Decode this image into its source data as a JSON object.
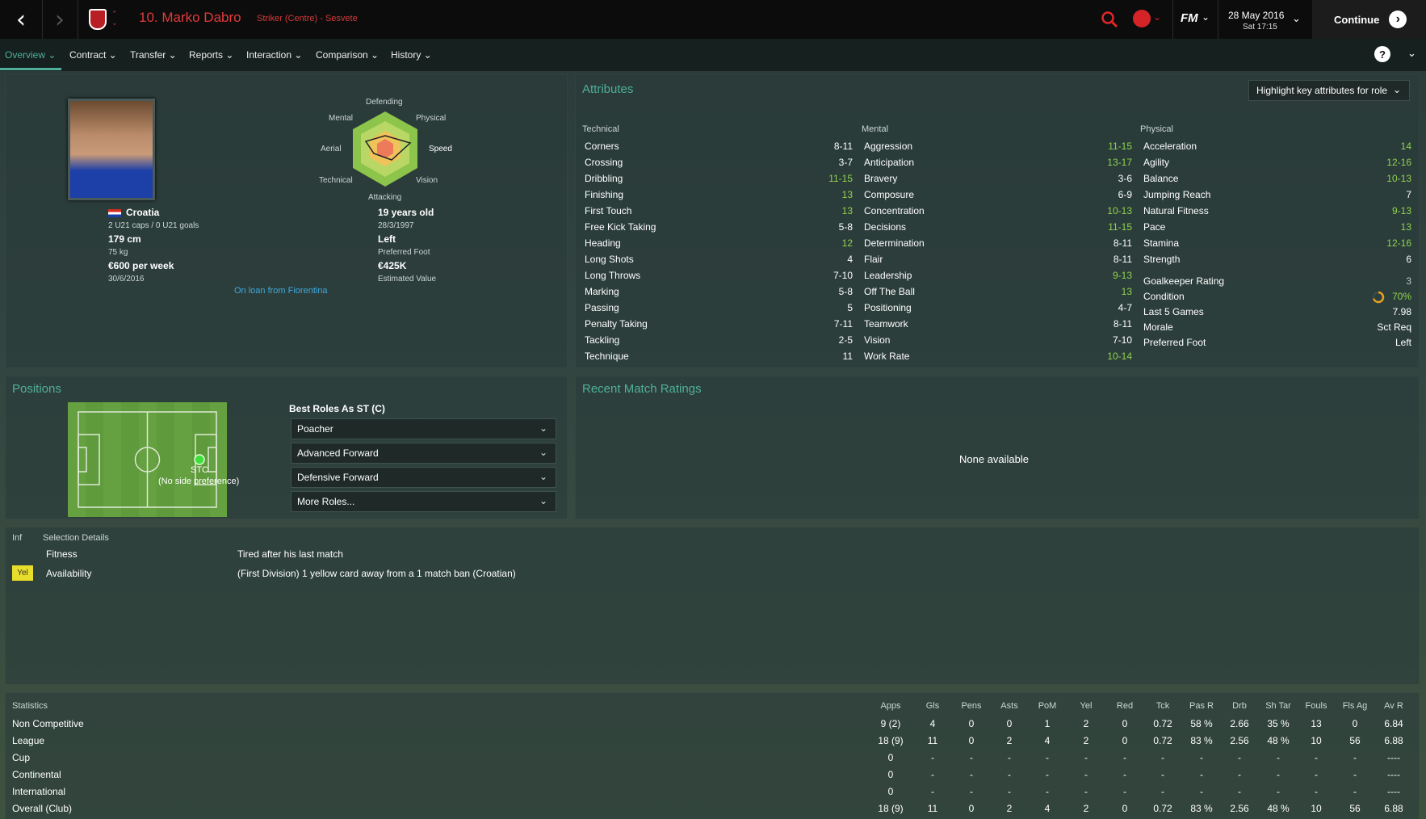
{
  "topbar": {
    "title": "10. Marko Dabro",
    "subtitle": "Striker (Centre) - Sesvete",
    "date": "28 May 2016",
    "day_time": "Sat 17:15",
    "continue": "Continue",
    "logo": "FM"
  },
  "tabs": [
    {
      "label": "Overview ⌄"
    },
    {
      "label": "Contract ⌄"
    },
    {
      "label": "Transfer ⌄"
    },
    {
      "label": "Reports ⌄"
    },
    {
      "label": "Interaction ⌄"
    },
    {
      "label": "Comparison ⌄"
    },
    {
      "label": "History ⌄"
    }
  ],
  "profile": {
    "nation": "Croatia",
    "caps": "2 U21 caps / 0 U21 goals",
    "height": "179 cm",
    "weight": "75 kg",
    "wage": "€600 per week",
    "contract_end": "30/6/2016",
    "age": "19 years old",
    "dob": "28/3/1997",
    "foot": "Left",
    "foot_label": "Preferred Foot",
    "value": "€425K",
    "value_label": "Estimated Value",
    "loan": "On loan from Fiorentina"
  },
  "radar": {
    "labels": {
      "top": "Defending",
      "tr": "Physical",
      "right": "Speed",
      "br": "Vision",
      "bottom": "Attacking",
      "bl": "Technical",
      "left": "Aerial",
      "tl": "Mental"
    }
  },
  "attributes": {
    "title": "Attributes",
    "highlight": "Highlight key attributes for role",
    "technical_title": "Technical",
    "mental_title": "Mental",
    "physical_title": "Physical",
    "technical": [
      [
        "Corners",
        "8-11"
      ],
      [
        "Crossing",
        "3-7"
      ],
      [
        "Dribbling",
        "11-15"
      ],
      [
        "Finishing",
        "13"
      ],
      [
        "First Touch",
        "13"
      ],
      [
        "Free Kick Taking",
        "5-8"
      ],
      [
        "Heading",
        "12"
      ],
      [
        "Long Shots",
        "4"
      ],
      [
        "Long Throws",
        "7-10"
      ],
      [
        "Marking",
        "5-8"
      ],
      [
        "Passing",
        "5"
      ],
      [
        "Penalty Taking",
        "7-11"
      ],
      [
        "Tackling",
        "2-5"
      ],
      [
        "Technique",
        "11"
      ]
    ],
    "mental": [
      [
        "Aggression",
        "11-15"
      ],
      [
        "Anticipation",
        "13-17"
      ],
      [
        "Bravery",
        "3-6"
      ],
      [
        "Composure",
        "6-9"
      ],
      [
        "Concentration",
        "10-13"
      ],
      [
        "Decisions",
        "11-15"
      ],
      [
        "Determination",
        "8-11"
      ],
      [
        "Flair",
        "8-11"
      ],
      [
        "Leadership",
        "9-13"
      ],
      [
        "Off The Ball",
        "13"
      ],
      [
        "Positioning",
        "4-7"
      ],
      [
        "Teamwork",
        "8-11"
      ],
      [
        "Vision",
        "7-10"
      ],
      [
        "Work Rate",
        "10-14"
      ]
    ],
    "physical": [
      [
        "Acceleration",
        "14"
      ],
      [
        "Agility",
        "12-16"
      ],
      [
        "Balance",
        "10-13"
      ],
      [
        "Jumping Reach",
        "7"
      ],
      [
        "Natural Fitness",
        "9-13"
      ],
      [
        "Pace",
        "13"
      ],
      [
        "Stamina",
        "12-16"
      ],
      [
        "Strength",
        "6"
      ]
    ],
    "extra": [
      [
        "Goalkeeper Rating",
        "3"
      ],
      [
        "Condition",
        "70%"
      ],
      [
        "Last 5 Games",
        "7.98"
      ],
      [
        "Morale",
        "Sct Req"
      ],
      [
        "Preferred Foot",
        "Left"
      ]
    ],
    "condition": 0.7,
    "colors": {
      "good": "#8fd24e",
      "normal": "#ffffff",
      "dim": "#c0c8c6"
    }
  },
  "positions": {
    "title": "Positions",
    "marker": "STC",
    "marker_note": "(No side preference)",
    "best_roles_title": "Best Roles As ST (C)",
    "roles": [
      "Poacher",
      "Advanced Forward",
      "Defensive Forward",
      "More Roles..."
    ]
  },
  "ratings": {
    "title": "Recent Match Ratings",
    "empty": "None available"
  },
  "selection": {
    "col1": "Inf",
    "col2": "Selection Details",
    "rows": [
      {
        "badge": "",
        "label": "Fitness",
        "detail": "Tired after his last match"
      },
      {
        "badge": "Yel",
        "label": "Availability",
        "detail": "(First Division) 1 yellow card away from a 1 match ban (Croatian)"
      }
    ]
  },
  "stats": {
    "title": "Statistics",
    "headers": [
      "Apps",
      "Gls",
      "Pens",
      "Asts",
      "PoM",
      "Yel",
      "Red",
      "Tck",
      "Pas R",
      "Drb",
      "Sh Tar",
      "Fouls",
      "Fls Ag",
      "Av R"
    ],
    "rows": [
      {
        "name": "Non Competitive",
        "v": [
          "9 (2)",
          "4",
          "0",
          "0",
          "1",
          "2",
          "0",
          "0.72",
          "58 %",
          "2.66",
          "35 %",
          "13",
          "0",
          "6.84"
        ]
      },
      {
        "name": "League",
        "v": [
          "18 (9)",
          "11",
          "0",
          "2",
          "4",
          "2",
          "0",
          "0.72",
          "83 %",
          "2.56",
          "48 %",
          "10",
          "56",
          "6.88"
        ]
      },
      {
        "name": "Cup",
        "v": [
          "0",
          "-",
          "-",
          "-",
          "-",
          "-",
          "-",
          "-",
          "-",
          "-",
          "-",
          "-",
          "-",
          "----"
        ]
      },
      {
        "name": "Continental",
        "v": [
          "0",
          "-",
          "-",
          "-",
          "-",
          "-",
          "-",
          "-",
          "-",
          "-",
          "-",
          "-",
          "-",
          "----"
        ]
      },
      {
        "name": "International",
        "v": [
          "0",
          "-",
          "-",
          "-",
          "-",
          "-",
          "-",
          "-",
          "-",
          "-",
          "-",
          "-",
          "-",
          "----"
        ]
      },
      {
        "name": "Overall (Club)",
        "v": [
          "18 (9)",
          "11",
          "0",
          "2",
          "4",
          "2",
          "0",
          "0.72",
          "83 %",
          "2.56",
          "48 %",
          "10",
          "56",
          "6.88"
        ]
      }
    ]
  }
}
